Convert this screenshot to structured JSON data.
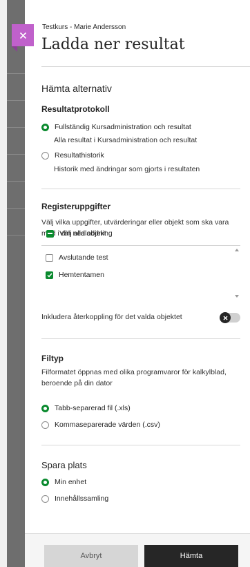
{
  "header": {
    "subtitle": "Testkurs - Marie Andersson",
    "title": "Ladda ner resultat"
  },
  "sections": {
    "options_title": "Hämta alternativ",
    "protocol": {
      "title": "Resultatprotokoll",
      "options": [
        {
          "label": "Fullständig Kursadministration och resultat",
          "sub": "Alla resultat i Kursadministration och resultat",
          "selected": true
        },
        {
          "label": "Resultathistorik",
          "sub": "Historik med ändringar som gjorts i resultaten",
          "selected": false
        }
      ]
    },
    "register": {
      "title": "Registeruppgifter",
      "description": "Välj vilka uppgifter, utvärderingar eller objekt som ska vara med i din nedladdning",
      "select_all": "Välj alla objekt",
      "items": [
        {
          "label": "Avslutande test",
          "checked": false
        },
        {
          "label": "Hemtentamen",
          "checked": true
        }
      ],
      "feedback_label": "Inkludera återkoppling för det valda objektet",
      "feedback_enabled": false
    },
    "filetype": {
      "title": "Filtyp",
      "description": "Filformatet öppnas med olika programvaror för kalkylblad, beroende på din dator",
      "options": [
        {
          "label": "Tabb-separerad fil (.xls)",
          "selected": true
        },
        {
          "label": "Kommaseparerade värden (.csv)",
          "selected": false
        }
      ]
    },
    "location": {
      "title": "Spara plats",
      "options": [
        {
          "label": "Min enhet",
          "selected": true
        },
        {
          "label": "Innehållssamling",
          "selected": false
        }
      ]
    }
  },
  "footer": {
    "cancel_label": "Avbryt",
    "submit_label": "Hämta"
  },
  "colors": {
    "accent_green": "#0a8a2e",
    "close_tab": "#c061cb",
    "primary_button": "#262626"
  },
  "icons": {
    "close": "close-icon",
    "check": "check-icon",
    "toggle_off": "toggle-x-icon"
  }
}
